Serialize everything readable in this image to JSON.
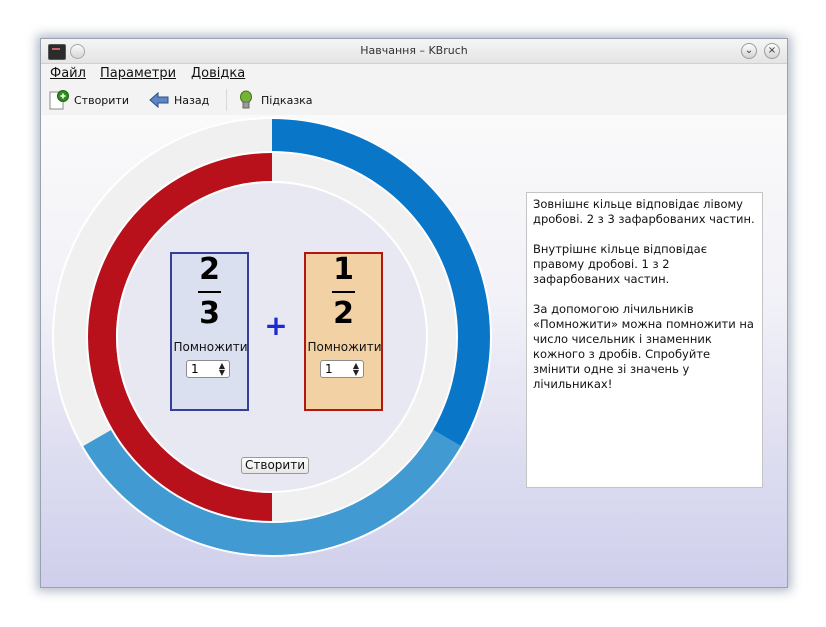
{
  "window": {
    "title": "Навчання – KBruch"
  },
  "menu": [
    "Файл",
    "Параметри",
    "Довідка"
  ],
  "toolbar": {
    "new_label": "Створити",
    "back_label": "Назад",
    "hint_label": "Підказка"
  },
  "exercise": {
    "left": {
      "numerator": "2",
      "denominator": "3",
      "multiply_label": "Помножити",
      "multiplier": "1"
    },
    "operator": "+",
    "right": {
      "numerator": "1",
      "denominator": "2",
      "multiply_label": "Помножити",
      "multiplier": "1"
    },
    "create_button": "Створити"
  },
  "rings": {
    "outer": {
      "filled": 2,
      "parts": 3,
      "colors": [
        "#0a76c8",
        "#419ad1"
      ]
    },
    "inner": {
      "filled": 1,
      "parts": 2,
      "color": "#b8111b"
    },
    "empty_color": "#f0f0f0"
  },
  "info": {
    "p1": "Зовнішнє кільце відповідає лівому дробові. 2 з 3 зафарбованих частин.",
    "p2": "Внутрішнє кільце відповідає правому дробові. 1 з 2 зафарбованих частин.",
    "p3": "За допомогою лічильників «Помножити» можна помножити на число чисельник і знаменник кожного з дробів. Спробуйте змінити одне зі значень у лічильниках!"
  },
  "colors": {
    "left_border": "#333f98",
    "right_border": "#b41612",
    "operator": "#1a2bd1"
  }
}
